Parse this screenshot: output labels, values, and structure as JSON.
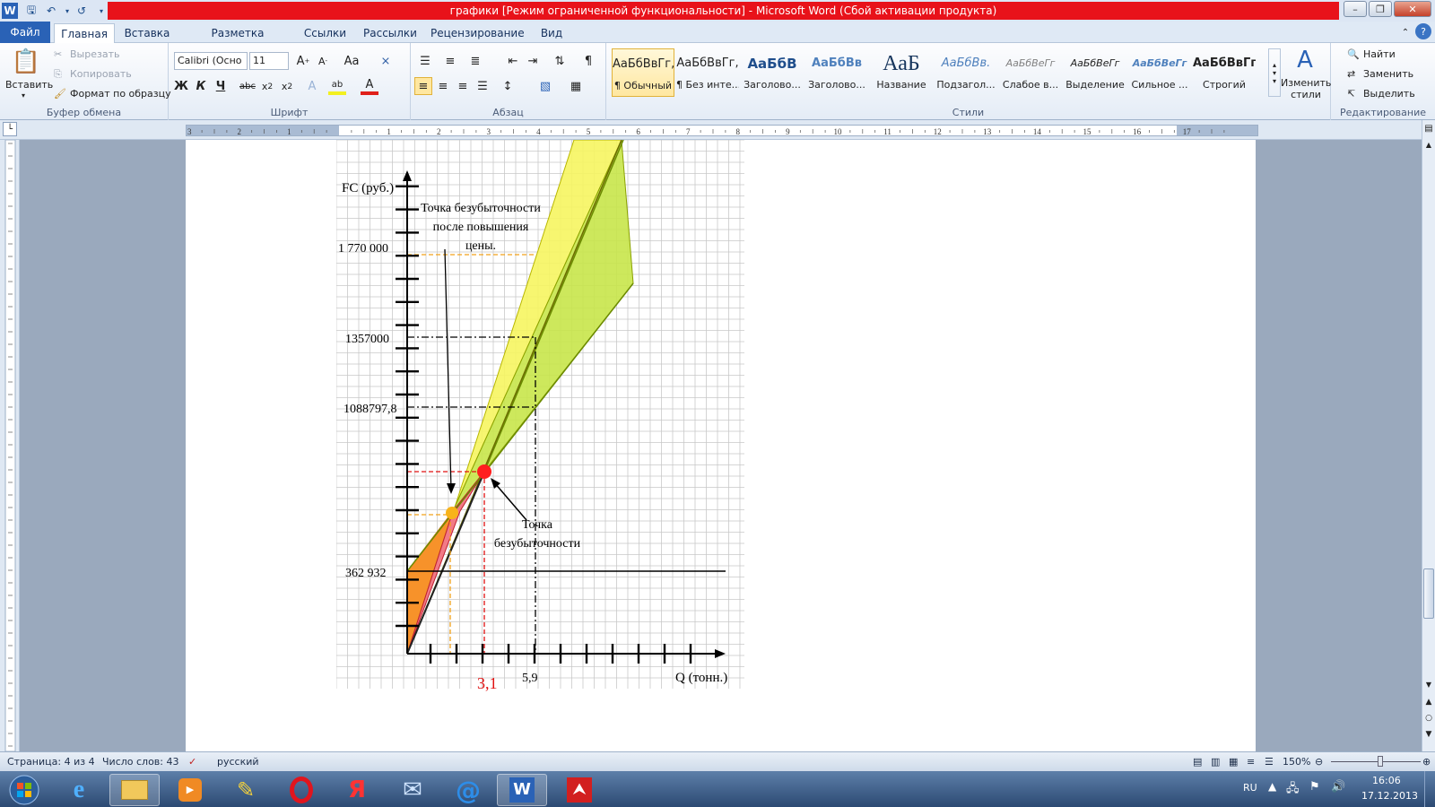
{
  "window": {
    "title": "графики [Режим ограниченной функциональности]  -  Microsoft Word (Сбой активации продукта)"
  },
  "tabs": [
    "Файл",
    "Главная",
    "Вставка",
    "Разметка страницы",
    "Ссылки",
    "Рассылки",
    "Рецензирование",
    "Вид"
  ],
  "active_tab": "Главная",
  "ribbon": {
    "clipboard": {
      "paste": "Вставить",
      "cut": "Вырезать",
      "copy": "Копировать",
      "format_painter": "Формат по образцу",
      "label": "Буфер обмена"
    },
    "font": {
      "name": "Calibri (Осно",
      "size": "11",
      "label": "Шрифт",
      "bold": "Ж",
      "italic": "К",
      "underline": "Ч"
    },
    "paragraph": {
      "label": "Абзац"
    },
    "styles": {
      "label": "Стили",
      "items": [
        {
          "sample": "АаБбВвГг,",
          "name": "¶ Обычный"
        },
        {
          "sample": "АаБбВвГг,",
          "name": "¶ Без инте..."
        },
        {
          "sample": "АаБбВ",
          "name": "Заголово..."
        },
        {
          "sample": "АаБбВв",
          "name": "Заголово..."
        },
        {
          "sample": "АаБ",
          "name": "Название"
        },
        {
          "sample": "АаБбВв.",
          "name": "Подзагол..."
        },
        {
          "sample": "АаБбВеГг",
          "name": "Слабое в..."
        },
        {
          "sample": "АаБбВеГг",
          "name": "Выделение"
        },
        {
          "sample": "АаБбВеГг",
          "name": "Сильное ..."
        },
        {
          "sample": "АаБбВвГг,",
          "name": "Строгий"
        }
      ],
      "change_styles": "Изменить стили"
    },
    "editing": {
      "label": "Редактирование",
      "find": "Найти",
      "replace": "Заменить",
      "select": "Выделить"
    }
  },
  "ruler_numbers": [
    "3",
    "2",
    "1",
    "1",
    "2",
    "3",
    "4",
    "5",
    "6",
    "7",
    "8",
    "9",
    "10",
    "11",
    "12",
    "13",
    "14",
    "15",
    "16",
    "17"
  ],
  "chart": {
    "y_axis_label": "FC (руб.)",
    "x_axis_label": "Q (тонн.)",
    "y_ticks": [
      "1 770 000",
      "1357000",
      "1088797,8",
      "362 932"
    ],
    "x_ticks": [
      "3,1",
      "5,9"
    ],
    "annotation_new": "Точка безубыточности после повышения цены.",
    "annotation_new_lines": [
      "Точка безубыточности",
      "после повышения",
      "цены."
    ],
    "annotation_bep_lines": [
      "Точка",
      "безубыточности"
    ],
    "colors": {
      "yellow_fill": "#f6f560",
      "green_fill": "#c8e64a",
      "orange_fill": "#f7922a",
      "pink_fill": "#f27a86",
      "bep_point": "#ff1f1f",
      "new_bep_point": "#f8b31a",
      "red_guides": "#e01010",
      "orange_guides": "#f2a21a"
    }
  },
  "status": {
    "page": "Страница: 4 из 4",
    "words": "Число слов: 43",
    "language": "русский",
    "zoom": "150%"
  },
  "taskbar": {
    "lang": "RU",
    "time": "16:06",
    "date": "17.12.2013"
  }
}
